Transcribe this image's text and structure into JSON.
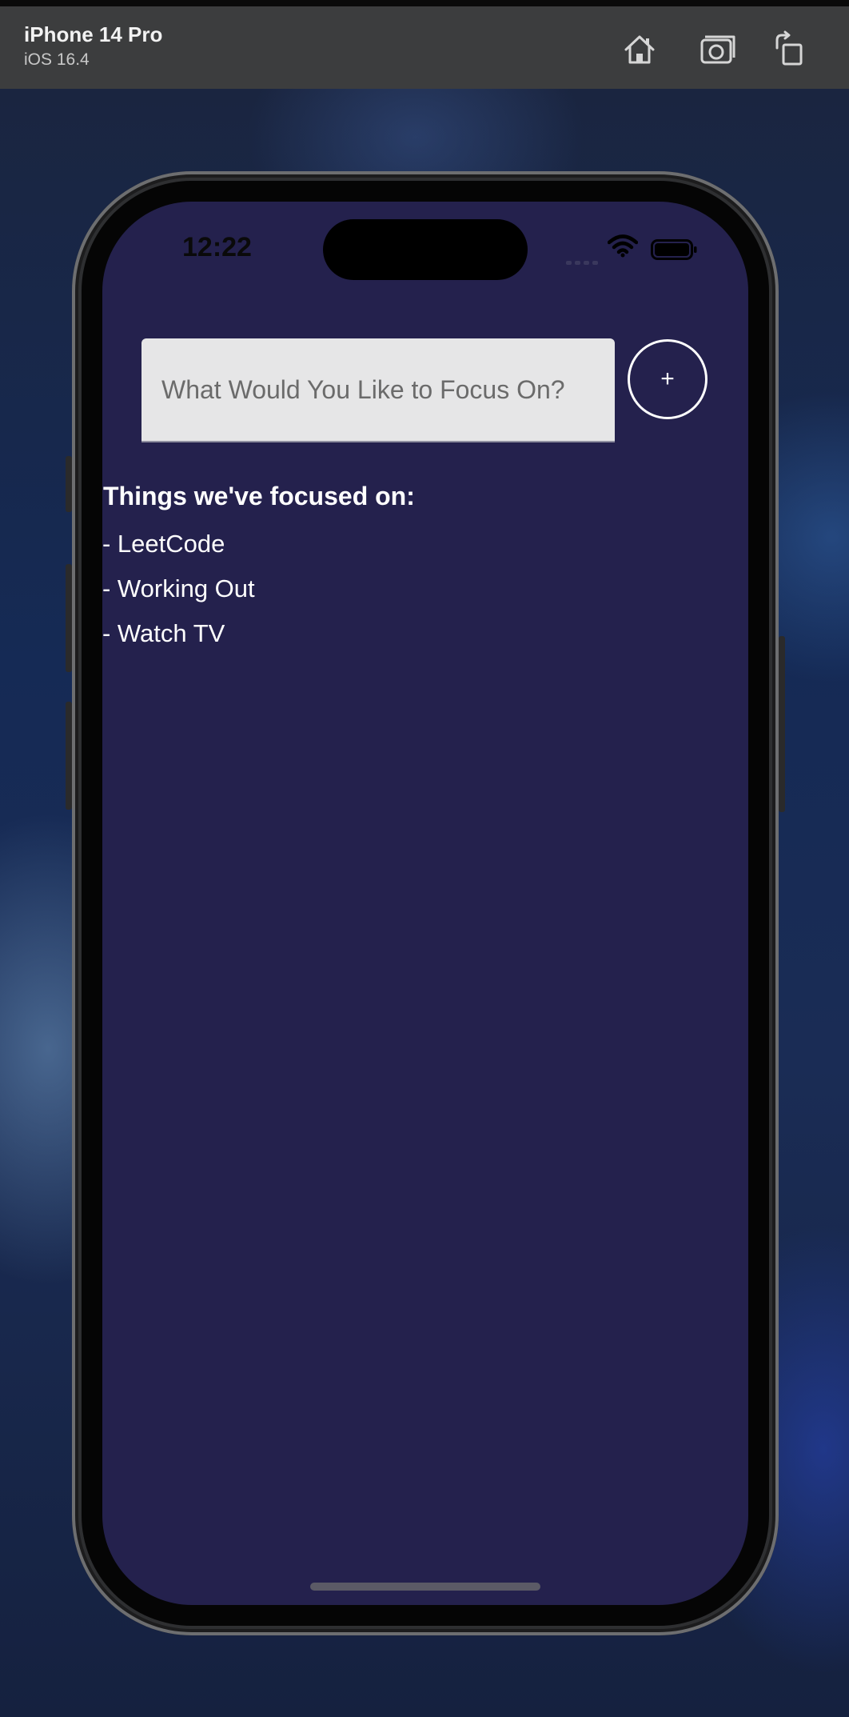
{
  "simulator": {
    "device_name": "iPhone 14 Pro",
    "os_version": "iOS 16.4",
    "buttons": [
      {
        "name": "home-button",
        "icon": "home-icon"
      },
      {
        "name": "screenshot-button",
        "icon": "camera-icon"
      },
      {
        "name": "rotate-button",
        "icon": "rotate-icon"
      }
    ]
  },
  "status_bar": {
    "time": "12:22",
    "icons": [
      "wifi-icon",
      "battery-icon"
    ]
  },
  "app": {
    "background_color": "#24214d",
    "input": {
      "placeholder": "What Would You Like to Focus On?",
      "value": ""
    },
    "add_button_label": "+",
    "list_heading": "Things we've focused on:",
    "items": [
      " - LeetCode",
      " - Working Out",
      " - Watch TV"
    ]
  }
}
